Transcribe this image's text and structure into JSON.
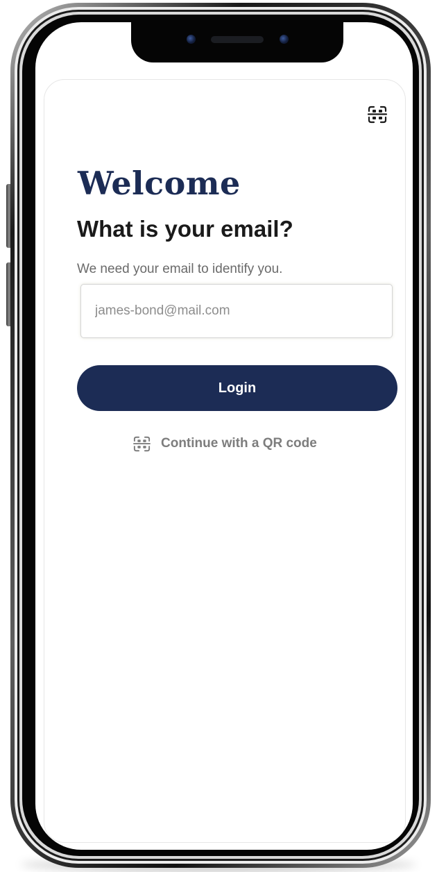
{
  "screen": {
    "title": "Welcome",
    "subtitle": "What is your email?",
    "hint": "We need your email to identify you.",
    "email_input": {
      "value": "",
      "placeholder": "james-bond@mail.com"
    },
    "login_label": "Login",
    "qr_link_label": "Continue with a QR code"
  },
  "icons": {
    "header_qr": "qr-scan-icon",
    "link_qr": "qr-scan-icon"
  },
  "colors": {
    "brand_navy": "#1c2c55",
    "button_text": "#ffffff",
    "muted_text": "#7d7d7d",
    "body_text": "#1a1a1a"
  }
}
